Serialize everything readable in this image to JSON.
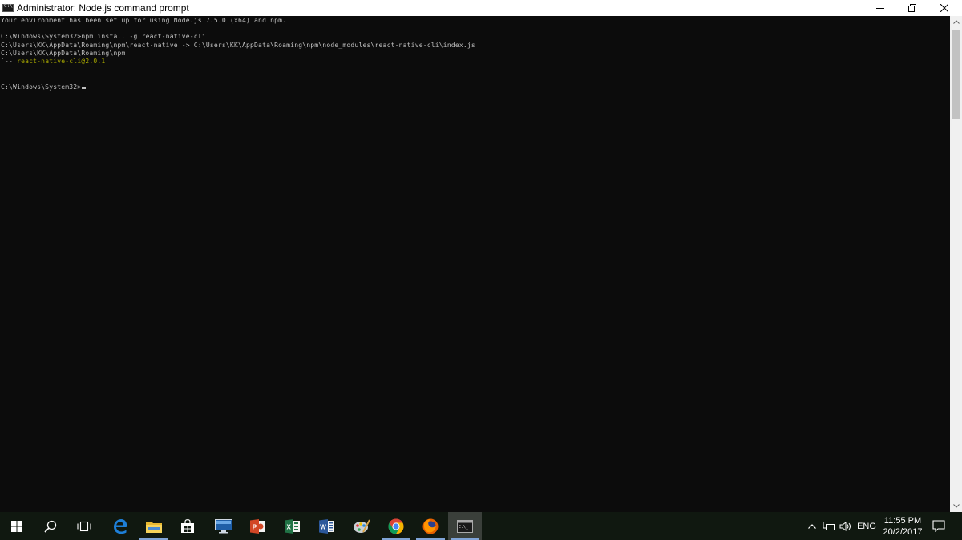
{
  "window": {
    "title": "Administrator: Node.js command prompt"
  },
  "console": {
    "lines": [
      "Your environment has been set up for using Node.js 7.5.0 (x64) and npm.",
      "",
      "C:\\Windows\\System32>npm install -g react-native-cli",
      "C:\\Users\\KK\\AppData\\Roaming\\npm\\react-native -> C:\\Users\\KK\\AppData\\Roaming\\npm\\node_modules\\react-native-cli\\index.js",
      "C:\\Users\\KK\\AppData\\Roaming\\npm"
    ],
    "tree_prefix": "`-- ",
    "package": "react-native-cli@2.0.1",
    "prompt": "C:\\Windows\\System32>"
  },
  "taskbar": {
    "apps": [
      {
        "name": "start-button",
        "icon": "windows-logo-icon"
      },
      {
        "name": "search-button",
        "icon": "search-icon"
      },
      {
        "name": "task-view-button",
        "icon": "task-view-icon"
      },
      {
        "name": "edge-button",
        "icon": "edge-icon"
      },
      {
        "name": "file-explorer-button",
        "icon": "folder-icon"
      },
      {
        "name": "store-button",
        "icon": "store-bag-icon"
      },
      {
        "name": "remote-desktop-button",
        "icon": "monitor-icon"
      },
      {
        "name": "powerpoint-button",
        "icon": "powerpoint-icon"
      },
      {
        "name": "excel-button",
        "icon": "excel-icon"
      },
      {
        "name": "word-button",
        "icon": "word-icon"
      },
      {
        "name": "paint-button",
        "icon": "paint-icon"
      },
      {
        "name": "chrome-button",
        "icon": "chrome-icon"
      },
      {
        "name": "firefox-button",
        "icon": "firefox-icon"
      },
      {
        "name": "cmd-button",
        "icon": "cmd-icon"
      }
    ],
    "tray": {
      "language": "ENG",
      "time": "11:55 PM",
      "date": "20/2/2017"
    }
  },
  "colors": {
    "console_bg": "#0c0c0c",
    "console_text": "#c0c0c0",
    "package_text": "#a8a800",
    "taskbar_bg": "#101810",
    "active_indicator": "#7fa3d6"
  }
}
